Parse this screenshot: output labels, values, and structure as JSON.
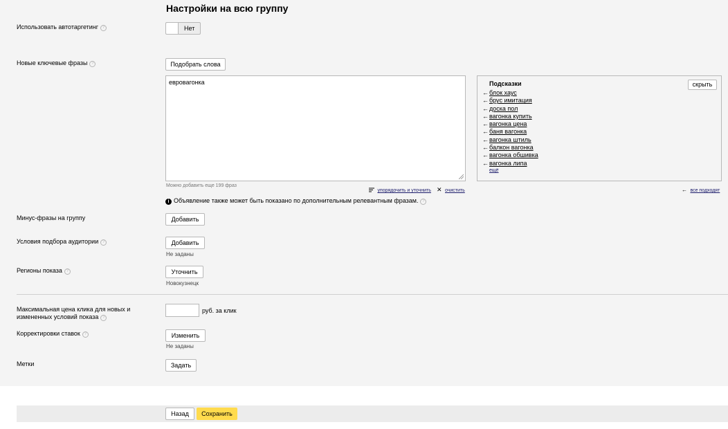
{
  "title": "Настройки на всю группу",
  "autotargeting": {
    "label": "Использовать автотаргетинг",
    "toggle_label": "Нет"
  },
  "keywords": {
    "label": "Новые ключевые фразы",
    "pick_button": "Подобрать слова",
    "value": "евровагонка",
    "remaining_note": "Можно добавить еще 199 фраз",
    "sort_link": "упорядочить и уточнить",
    "clear_link": "очистить"
  },
  "hints": {
    "title": "Подсказки",
    "hide_button": "скрыть",
    "items": [
      "блок хаус",
      "брус имитация",
      "доска пол",
      "вагонка купить",
      "вагонка цена",
      "баня вагонка",
      "вагонка штиль",
      "балкон вагонка",
      "вагонка обшивка",
      "вагонка липа"
    ],
    "more_link": "ещё",
    "all_fit_link": "все подходят"
  },
  "info_note": "Объявление также может быть показано по дополнительным релевантным фразам.",
  "minus_phrases": {
    "label": "Минус-фразы на группу",
    "button": "Добавить"
  },
  "audience": {
    "label": "Условия подбора аудитории",
    "button": "Добавить",
    "status": "Не заданы"
  },
  "regions": {
    "label": "Регионы показа",
    "button": "Уточнить",
    "value": "Новокузнецк"
  },
  "max_price": {
    "label_line1": "Максимальная цена клика для новых и",
    "label_line2": "измененных условий показа",
    "unit": "руб. за клик",
    "value": ""
  },
  "bid_adjustments": {
    "label": "Корректировки ставок",
    "button": "Изменить",
    "status": "Не заданы"
  },
  "tags": {
    "label": "Метки",
    "button": "Задать"
  },
  "footer": {
    "back_button": "Назад",
    "save_button": "Сохранить"
  },
  "colors": {
    "save_accent": "#ffdb4d",
    "panel_bg": "#f4f4f4"
  }
}
